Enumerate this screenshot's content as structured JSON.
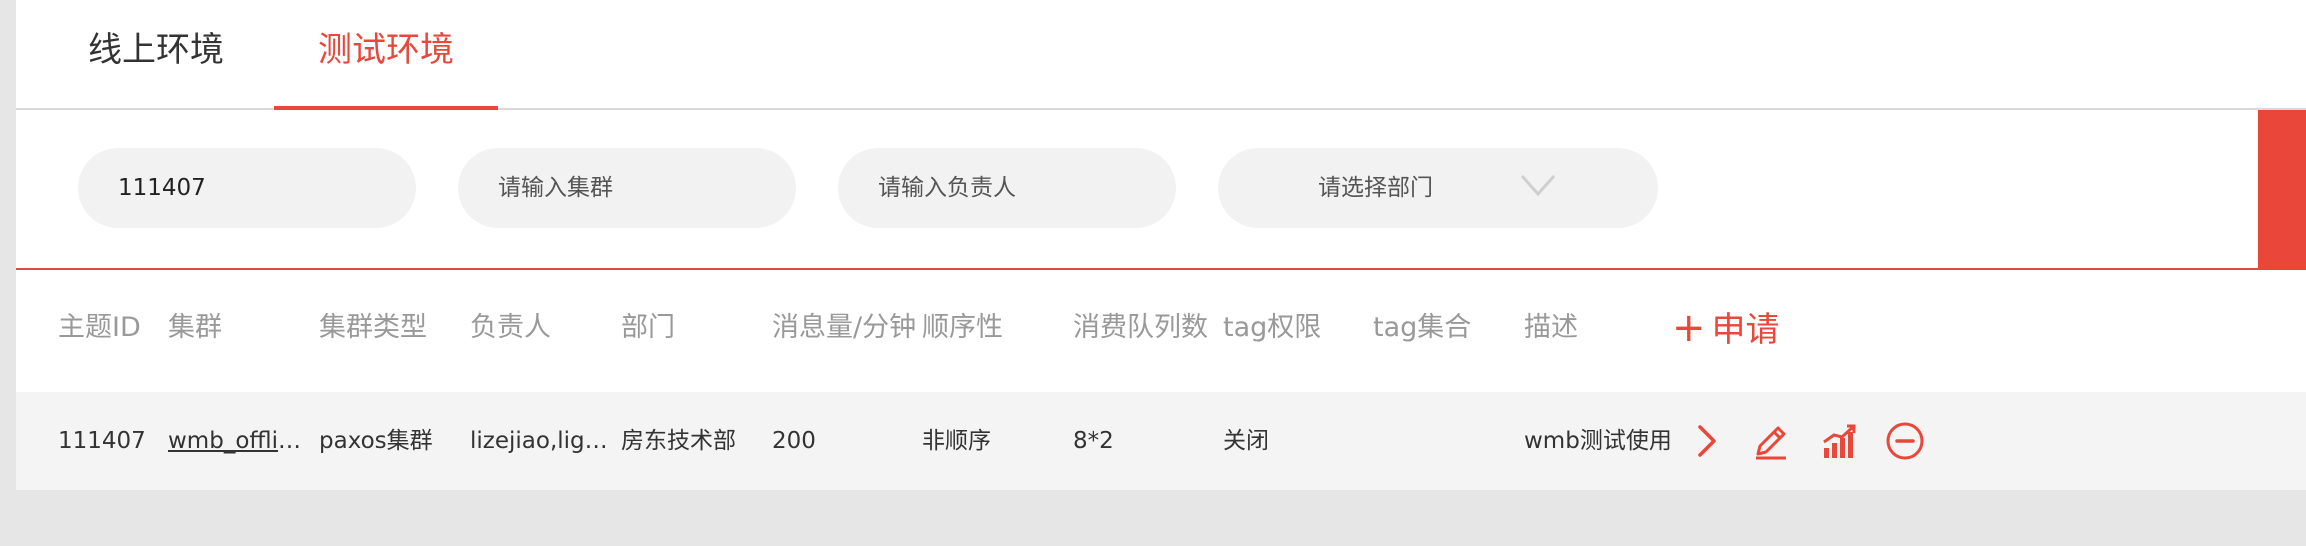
{
  "tabs": [
    {
      "label": "线上环境",
      "active": false
    },
    {
      "label": "测试环境",
      "active": true
    }
  ],
  "filters": {
    "topic_id": {
      "value": "111407",
      "placeholder": ""
    },
    "cluster": {
      "value": "",
      "placeholder": "请输入集群"
    },
    "owner": {
      "value": "",
      "placeholder": "请输入负责人"
    },
    "department": {
      "placeholder": "请选择部门"
    }
  },
  "table": {
    "headers": [
      "主题ID",
      "集群",
      "集群类型",
      "负责人",
      "部门",
      "消息量/分钟",
      "顺序性",
      "消费队列数",
      "tag权限",
      "tag集合",
      "描述"
    ],
    "add_label": "申请",
    "rows": [
      {
        "topic_id": "111407",
        "cluster": "wmb_offline_cluster",
        "cluster_type": "paxos集群",
        "owner": "lizejiao,liguiyang",
        "department": "房东技术部",
        "msg_per_min": "200",
        "order": "非顺序",
        "queues": "8*2",
        "tag_permission": "关闭",
        "tag_set": "",
        "description": "wmb测试使用"
      }
    ]
  },
  "colors": {
    "accent": "#e8473a",
    "header_text": "#999999",
    "row_bg": "#f4f4f4"
  },
  "icons": {
    "row_actions": [
      "chevron-right-icon",
      "edit-pencil-icon",
      "stats-chart-icon",
      "remove-circle-icon"
    ]
  }
}
